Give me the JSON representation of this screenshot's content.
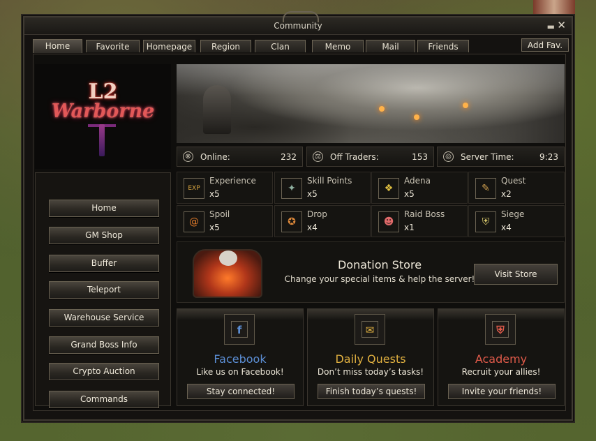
{
  "window": {
    "title": "Community",
    "min_glyph": "▬",
    "close_glyph": "✕"
  },
  "tabs": [
    {
      "label": "Home",
      "active": true
    },
    {
      "label": "Favorite"
    },
    {
      "label": "Homepage"
    },
    {
      "label": "Region"
    },
    {
      "label": "Clan"
    },
    {
      "label": "Memo"
    },
    {
      "label": "Mail"
    },
    {
      "label": "Friends"
    }
  ],
  "add_fav_label": "Add Fav.",
  "logo": {
    "line1": "L2",
    "line2": "Warborne"
  },
  "stats": [
    {
      "label": "Online:",
      "value": "232",
      "icon": "globe-icon",
      "glyph": "⊗"
    },
    {
      "label": "Off Traders:",
      "value": "153",
      "icon": "scales-icon",
      "glyph": "⚖"
    },
    {
      "label": "Server Time:",
      "value": "9:23",
      "icon": "clock-icon",
      "glyph": "◎"
    }
  ],
  "menu": [
    {
      "label": "Home"
    },
    {
      "label": "GM Shop"
    },
    {
      "label": "Buffer"
    },
    {
      "label": "Teleport"
    },
    {
      "label": "Warehouse Service"
    },
    {
      "label": "Grand Boss Info"
    },
    {
      "label": "Crypto Auction"
    },
    {
      "label": "Commands"
    }
  ],
  "rates": [
    {
      "name": "Experience",
      "mult": "x5",
      "icon": "exp-icon",
      "glyph": "EXP",
      "color": "#d9a640"
    },
    {
      "name": "Skill Points",
      "mult": "x5",
      "icon": "skill-points-icon",
      "glyph": "✦",
      "color": "#8fb0a0"
    },
    {
      "name": "Adena",
      "mult": "x5",
      "icon": "adena-icon",
      "glyph": "❖",
      "color": "#e0c040"
    },
    {
      "name": "Quest",
      "mult": "x2",
      "icon": "quest-scroll-icon",
      "glyph": "✎",
      "color": "#d0a050"
    },
    {
      "name": "Spoil",
      "mult": "x5",
      "icon": "spoil-icon",
      "glyph": "@",
      "color": "#e07a2a"
    },
    {
      "name": "Drop",
      "mult": "x4",
      "icon": "drop-bag-icon",
      "glyph": "✪",
      "color": "#e08a3a"
    },
    {
      "name": "Raid Boss",
      "mult": "x1",
      "icon": "raid-boss-icon",
      "glyph": "☻",
      "color": "#e06a6a"
    },
    {
      "name": "Siege",
      "mult": "x4",
      "icon": "siege-shield-icon",
      "glyph": "⛨",
      "color": "#e0d070"
    }
  ],
  "donation": {
    "title": "Donation Store",
    "subtitle": "Change your special items & help the server!",
    "button": "Visit Store"
  },
  "cards": [
    {
      "title": "Facebook",
      "subtitle": "Like us on Facebook!",
      "button": "Stay connected!",
      "color": "#5c8fd6",
      "icon": "facebook-icon",
      "glyph": "f"
    },
    {
      "title": "Daily Quests",
      "subtitle": "Don’t miss today’s tasks!",
      "button": "Finish today’s quests!",
      "color": "#e0b040",
      "icon": "scroll-icon",
      "glyph": "✉"
    },
    {
      "title": "Academy",
      "subtitle": "Recruit your allies!",
      "button": "Invite your friends!",
      "color": "#e05a4a",
      "icon": "shield-crest-icon",
      "glyph": "⛨"
    }
  ]
}
